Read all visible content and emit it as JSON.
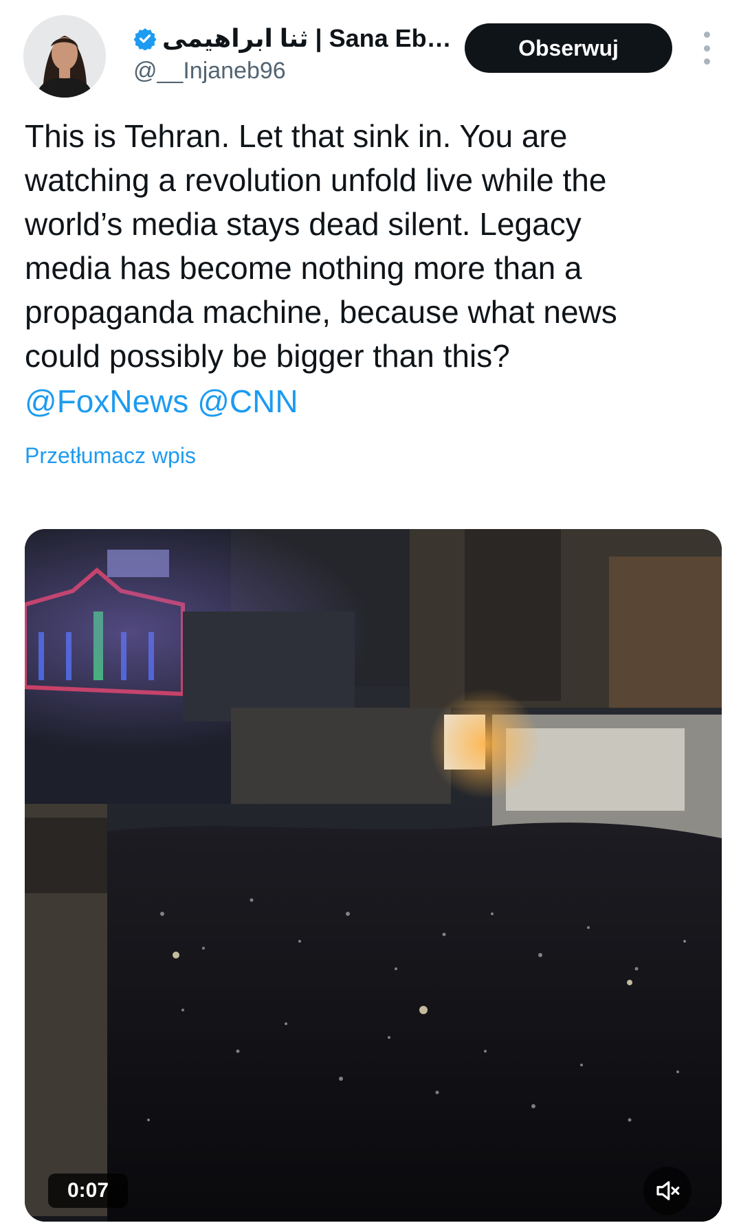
{
  "author": {
    "display_name": "ثنا ابراهیمی | Sana Eb…",
    "handle": "@__Injaneb96",
    "verified": true,
    "avatar_icon": "profile-photo"
  },
  "actions": {
    "follow_label": "Obserwuj",
    "more_icon": "more-vertical-icon"
  },
  "tweet": {
    "text": "This is Tehran. Let that sink in. You are\nwatching a revolution unfold live while the\nworld’s media stays dead silent. Legacy\nmedia has become nothing more than a\npropaganda machine, because what news\ncould possibly be bigger than this?",
    "mentions": [
      "@FoxNews",
      "@CNN"
    ],
    "translate_label": "Przetłumacz wpis"
  },
  "video": {
    "timecode": "0:07",
    "mute_icon": "volume-muted-icon"
  },
  "colors": {
    "accent": "#1d9bf0",
    "text": "#0f1419",
    "secondary": "#536471",
    "button_bg": "#0f1419"
  }
}
